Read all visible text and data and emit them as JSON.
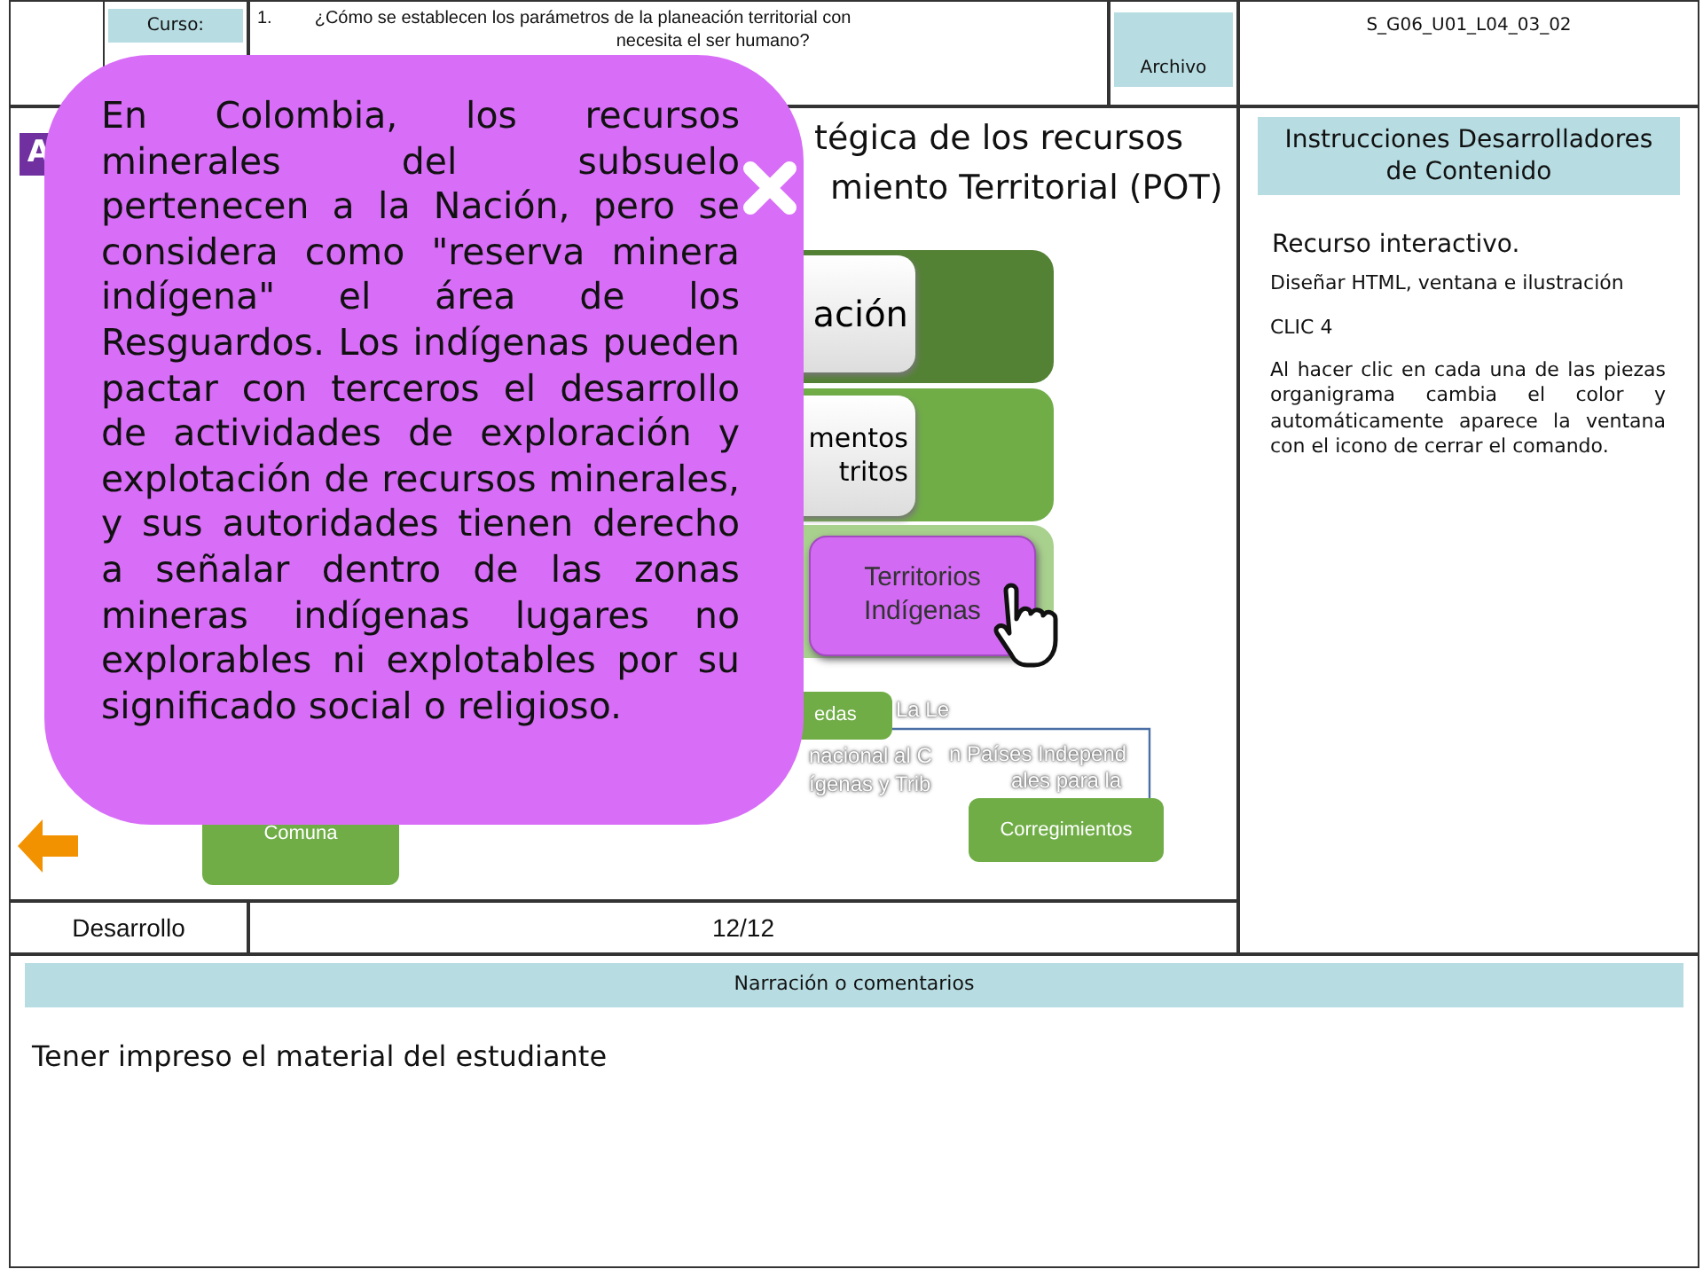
{
  "header": {
    "course_label": "Curso:",
    "question_number": "1.",
    "question_lines": [
      "¿Cómo se establecen los parámetros de la planeación territorial con",
      "necesita el ser humano?"
    ],
    "file_label": "Archivo",
    "file_code": "S_G06_U01_L04_03_02"
  },
  "slide": {
    "badge": "A",
    "title_lines": [
      "tégica de los recursos",
      "miento Territorial (POT)"
    ],
    "levels": [
      {
        "lines": [
          "ación"
        ],
        "color": "#548235",
        "selected": false
      },
      {
        "lines": [
          "mentos",
          "tritos"
        ],
        "color": "#70ad47",
        "selected": false
      },
      {
        "lines": [
          "Territorios",
          "Indígenas"
        ],
        "color": "#a9d18e",
        "selected": true
      }
    ],
    "boxes": [
      {
        "label": "Comuna"
      },
      {
        "label": "edas"
      },
      {
        "label": "Corregimientos"
      }
    ],
    "overflow_texts": [
      "La Le",
      "nacional al C",
      "ígenas y Trib",
      "n Países Independ",
      "ales para la"
    ],
    "popup": {
      "text": "En Colombia, los recursos minerales del subsuelo pertenecen a la Nación, pero se considera como \"reserva minera indígena\" el área de los Resguardos. Los indígenas pueden pactar con terceros el desarrollo de actividades de exploración y explotación de recursos minerales, y sus autoridades tienen derecho a señalar dentro de las zonas mineras indígenas lugares no explorables ni explotables por su significado social o religioso."
    }
  },
  "footer": {
    "section": "Desarrollo",
    "page": "12/12"
  },
  "instructions": {
    "title": "Instrucciones Desarrolladores de Contenido",
    "heading": "Recurso interactivo.",
    "paragraphs": [
      "Diseñar HTML, ventana e ilustración",
      "CLIC 4",
      "Al hacer clic en cada una de las piezas organigrama cambia el color y automáticamente aparece la ventana con el icono de cerrar el comando."
    ]
  },
  "narration": {
    "title": "Narración o comentarios",
    "text": "Tener impreso el material del estudiante"
  }
}
